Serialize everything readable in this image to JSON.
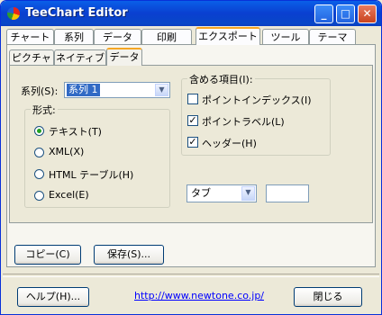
{
  "window": {
    "title": "TeeChart Editor",
    "controls": {
      "minimize": "_",
      "maximize": "□",
      "close": "✕"
    }
  },
  "main_tabs": [
    {
      "label": "チャート"
    },
    {
      "label": "系列"
    },
    {
      "label": "データ"
    },
    {
      "label": "印刷"
    },
    {
      "label": "エクスポート",
      "active": true
    },
    {
      "label": "ツール"
    },
    {
      "label": "テーマ"
    }
  ],
  "sub_tabs": [
    {
      "label": "ピクチャ"
    },
    {
      "label": "ネイティブ"
    },
    {
      "label": "データ",
      "active": true
    }
  ],
  "series": {
    "label": "系列(S):",
    "value": "系列 1"
  },
  "format": {
    "title": "形式:",
    "options": [
      {
        "label": "テキスト(T)",
        "selected": true
      },
      {
        "label": "XML(X)",
        "selected": false
      },
      {
        "label": "HTML テーブル(H)",
        "selected": false
      },
      {
        "label": "Excel(E)",
        "selected": false
      }
    ]
  },
  "include": {
    "title": "含める項目(I):",
    "items": [
      {
        "label": "ポイントインデックス(I)",
        "checked": false
      },
      {
        "label": "ポイントラベル(L)",
        "checked": true
      },
      {
        "label": "ヘッダー(H)",
        "checked": true
      }
    ]
  },
  "delimiter": {
    "value": "タブ",
    "custom": ""
  },
  "buttons": {
    "copy": "コピー(C)",
    "save": "保存(S)...",
    "help": "ヘルプ(H)...",
    "close": "閉じる"
  },
  "link": "http://www.newtone.co.jp/"
}
